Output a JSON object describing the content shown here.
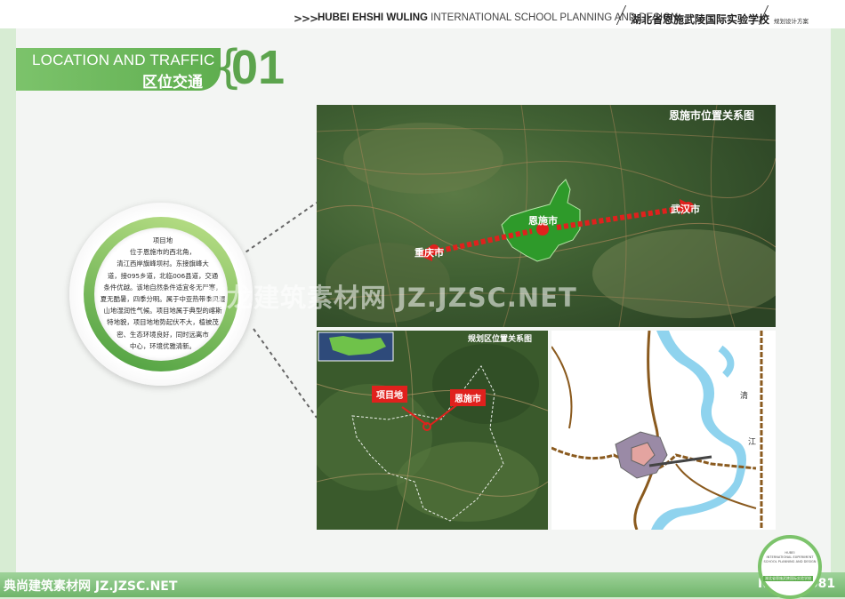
{
  "header": {
    "chevrons": ">>>",
    "title_bold": "HUBEI EHSHI WULING",
    "title_rest": "INTERNATIONAL SCHOOL PLANNING AND DESIGN",
    "title_cn": "湖北省恩施武陵国际实验学校",
    "subtitle_cn": "规划设计方案"
  },
  "section": {
    "title_en": "LOCATION AND TRAFFIC",
    "title_cn": "区位交通",
    "brace": "{",
    "number": "01"
  },
  "circle": {
    "heading": "项目地",
    "lines": [
      "位于恩施市的西北角，",
      "清江西岸旗峰坝村。东接旗峰大",
      "道，接095乡道，北临006县道，交通",
      "条件优越。该地自然条件适宜冬无严寒，",
      "夏无酷暑，四季分明。属于中亚热带季风湿",
      "山地湿润性气候。项目地属于典型的喀斯",
      "特地貌，项目地地势起伏不大，植被茂",
      "密、生态环境良好，同时远离市",
      "中心，环境优雅清新。"
    ]
  },
  "map_top": {
    "title": "恩施市位置关系图",
    "labels": {
      "enshi": "恩施市",
      "chongqing": "重庆市",
      "wuhan": "武汉市"
    }
  },
  "map_bottom_left": {
    "title": "规划区位置关系图",
    "labels": {
      "site": "项目地",
      "enshi": "恩施市"
    }
  },
  "map_bottom_right": {
    "labels": {
      "qing": "清",
      "jiang": "江"
    }
  },
  "watermark": "筑龙建筑素材网 JZ.JZSC.NET",
  "footer": {
    "left": "典尚建筑素材网 JZ.JZSC.NET",
    "right": "NO.193081"
  },
  "badge": {
    "lines": [
      "HUBEI",
      "INTERNATIONAL EXPERIMENT",
      "SCHOOL PLANNING AND DESIGN"
    ],
    "cn": "湖北省恩施武陵国际实验学校"
  },
  "colors": {
    "accent_green": "#5fae4f",
    "light_green": "#d7ecd3",
    "route_red": "#e0211d",
    "region_green": "#2e9a2a",
    "river_blue": "#8fd3ee",
    "road_brown": "#8a5a1e"
  }
}
